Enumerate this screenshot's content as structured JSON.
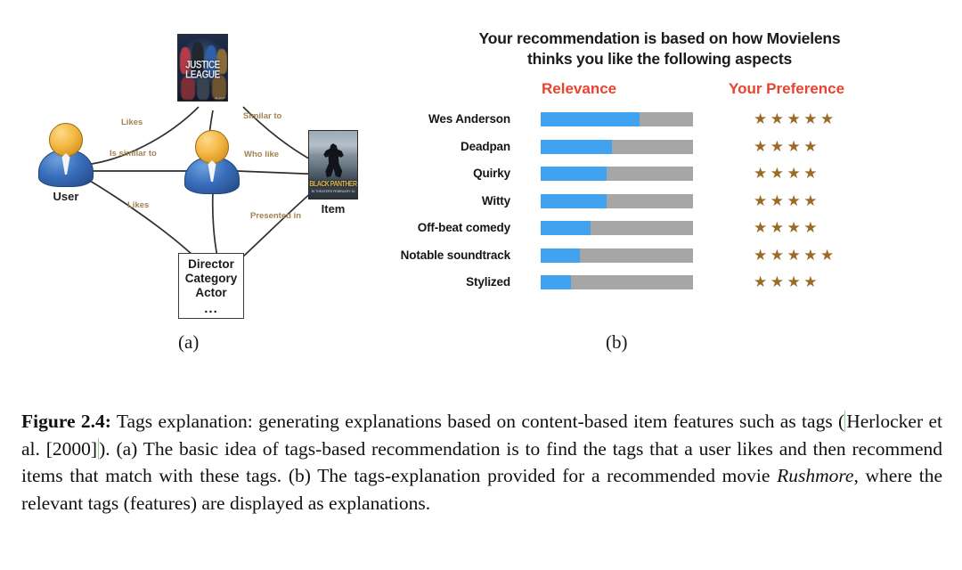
{
  "figure": {
    "subfigure_a_label": "(a)",
    "subfigure_b_label": "(b)"
  },
  "diagram": {
    "nodes": {
      "user": {
        "label": "User",
        "icon": "user-avatar-icon"
      },
      "middle_user": {
        "label": "",
        "icon": "user-avatar-icon"
      },
      "item": {
        "label": "Item",
        "poster_title": "BLACK PANTHER",
        "poster_sub": "IN THEATERS FEBRUARY 16"
      },
      "movie_top": {
        "poster_title_line1": "JUSTICE",
        "poster_title_line2": "LEAGUE",
        "poster_foot": "11.17.17"
      },
      "attributes": {
        "line1": "Director",
        "line2": "Category",
        "line3": "Actor",
        "dots": "..."
      }
    },
    "edge_labels": {
      "likes_top": "Likes",
      "similar_to": "Similar to",
      "is_similar_to": "Is similar to",
      "who_like": "Who like",
      "likes_bottom": "Likes",
      "presented_in": "Presented in"
    },
    "colors": {
      "edge_label": "#a4824f",
      "avatar_head": "#f3b843",
      "avatar_body": "#3a6fbd"
    }
  },
  "recommendation_panel": {
    "title_line1": "Your recommendation is based on how Movielens",
    "title_line2": "thinks you like the following aspects",
    "columns": {
      "relevance": "Relevance",
      "preference": "Your Preference"
    },
    "colors": {
      "header": "#e8432f",
      "bar_fill": "#41a2f0",
      "bar_track": "#a6a6a6",
      "star": "#9a6b25"
    },
    "star_glyph": "★"
  },
  "chart_data": {
    "type": "bar",
    "title": "Your recommendation is based on how Movielens thinks you like the following aspects",
    "xlabel": "",
    "ylabel": "",
    "xlim": [
      0,
      100
    ],
    "grid": false,
    "legend": "none",
    "orientation": "horizontal",
    "stacked": true,
    "categories": [
      "Wes Anderson",
      "Deadpan",
      "Quirky",
      "Witty",
      "Off-beat comedy",
      "Notable soundtrack",
      "Stylized"
    ],
    "series": [
      {
        "name": "Relevance",
        "color": "#41a2f0",
        "values": [
          65,
          47,
          43,
          43,
          33,
          26,
          20
        ]
      },
      {
        "name": "Remainder",
        "color": "#a6a6a6",
        "values": [
          35,
          53,
          57,
          57,
          67,
          74,
          80
        ]
      }
    ],
    "secondary_series": {
      "name": "Your Preference",
      "unit": "stars",
      "max": 5,
      "values": [
        5,
        4,
        4,
        4,
        4,
        5,
        4
      ]
    }
  },
  "caption": {
    "figure_number": "Figure 2.4:",
    "text_part_1": " Tags explanation: generating explanations based on content-based item features such as tags (",
    "citation": "Herlocker et al. [2000]",
    "text_part_2": "). (a) The basic idea of tags-based recommendation is to find the tags that a user likes and then recommend items that match with these tags. (b) The tags-explanation provided for a recommended movie ",
    "movie_title": "Rushmore",
    "text_part_3": ", where the relevant tags (features) are displayed as explanations."
  }
}
